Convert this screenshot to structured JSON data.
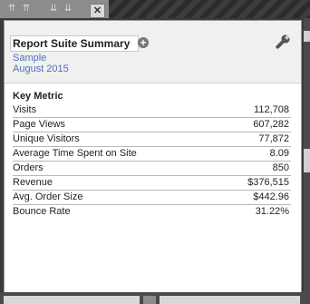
{
  "toolbar": {
    "close_label": "✕"
  },
  "panel": {
    "title": "Report Suite Summary",
    "add_symbol": "+",
    "suite_name": "Sample",
    "period": "August 2015",
    "metric_header": "Key Metric",
    "rows": [
      {
        "label": "Visits",
        "value": "112,708"
      },
      {
        "label": "Page Views",
        "value": "607,282"
      },
      {
        "label": "Unique Visitors",
        "value": "77,872"
      },
      {
        "label": "Average Time Spent on Site",
        "value": "8.09"
      },
      {
        "label": "Orders",
        "value": "850"
      },
      {
        "label": "Revenue",
        "value": "$376,515"
      },
      {
        "label": "Avg. Order Size",
        "value": "$442.96"
      },
      {
        "label": "Bounce Rate",
        "value": "31.22%"
      }
    ]
  },
  "icons": {
    "settings": "wrench-icon",
    "add": "plus-circle-icon",
    "close": "close-icon",
    "collapse": "double-arrow-up-icon",
    "expand": "double-arrow-down-icon"
  }
}
